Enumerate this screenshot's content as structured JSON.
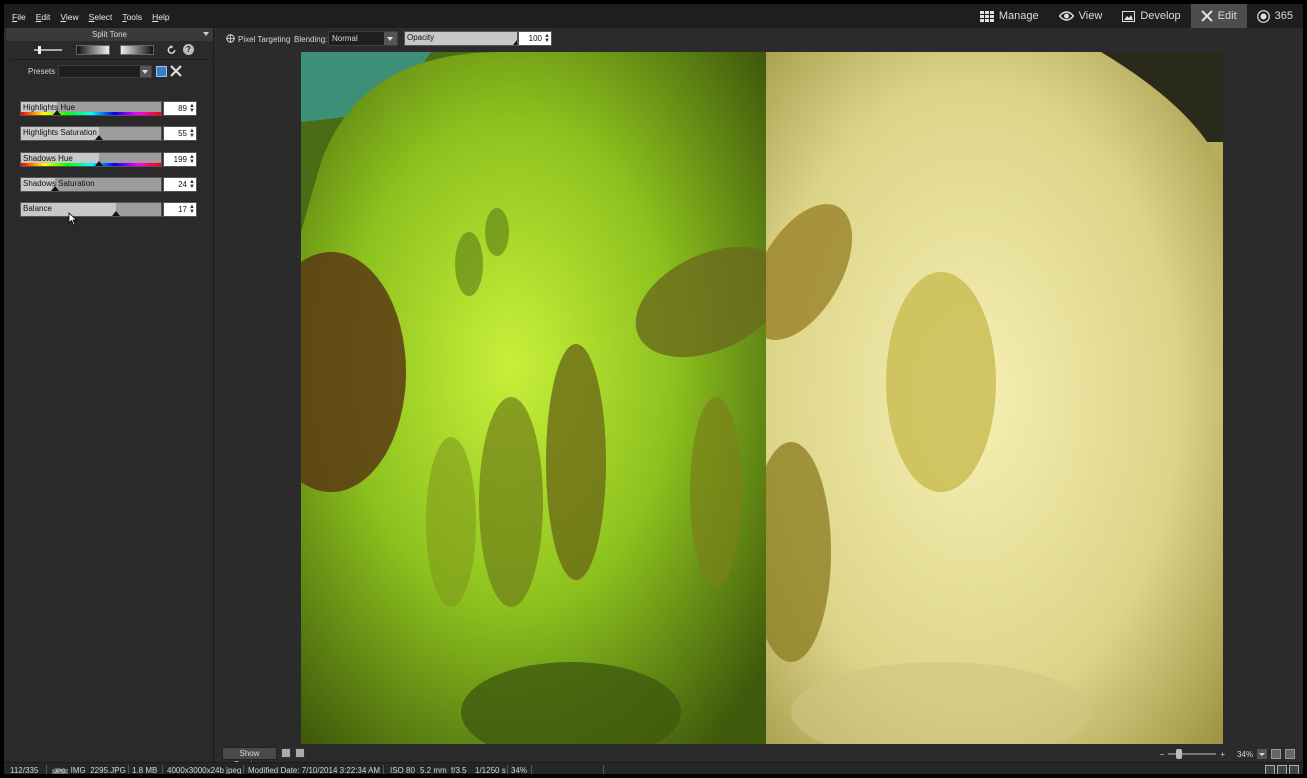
{
  "menu": [
    "File",
    "Edit",
    "View",
    "Select",
    "Tools",
    "Help"
  ],
  "modes": [
    {
      "label": "Manage",
      "icon": "grid-icon"
    },
    {
      "label": "View",
      "icon": "eye-icon"
    },
    {
      "label": "Develop",
      "icon": "image-icon"
    },
    {
      "label": "Edit",
      "icon": "tools-icon"
    },
    {
      "label": "365",
      "icon": "365-icon"
    }
  ],
  "active_mode": "Edit",
  "panel": {
    "title": "Split Tone",
    "presets_label": "Presets",
    "presets_value": "",
    "sliders": [
      {
        "label": "Highlights Hue",
        "value": "89",
        "fraction": 0.25,
        "hue": true
      },
      {
        "label": "Highlights Saturation",
        "value": "55",
        "fraction": 0.55,
        "hue": false
      },
      {
        "label": "Shadows Hue",
        "value": "199",
        "fraction": 0.55,
        "hue": true
      },
      {
        "label": "Shadows Saturation",
        "value": "24",
        "fraction": 0.24,
        "hue": false
      },
      {
        "label": "Balance",
        "value": "17",
        "fraction": 0.67,
        "hue": false
      }
    ],
    "done_label": "Done",
    "cancel_label": "Cancel"
  },
  "toolbar": {
    "pixel_targeting": "Pixel Targeting",
    "blending_label": "Blending:",
    "blending_value": "Normal",
    "opacity_label": "Opacity",
    "opacity_value": "100",
    "opacity_fraction": 1.0
  },
  "canvas_bottom": {
    "show_previous": "Show Previous",
    "zoom": "34%"
  },
  "status": {
    "index": "112/335",
    "filetype": "JPG",
    "filename": "IMG_2295.JPG",
    "size": "1.8 MB",
    "dimensions": "4000x3000x24b jpeg",
    "modified": "Modified Date: 7/10/2014 3:22:34 AM",
    "iso": "ISO 80",
    "focal": "5.2 mm",
    "aperture": "f/3.5",
    "shutter": "1/1250 s",
    "zoom": "34%"
  }
}
